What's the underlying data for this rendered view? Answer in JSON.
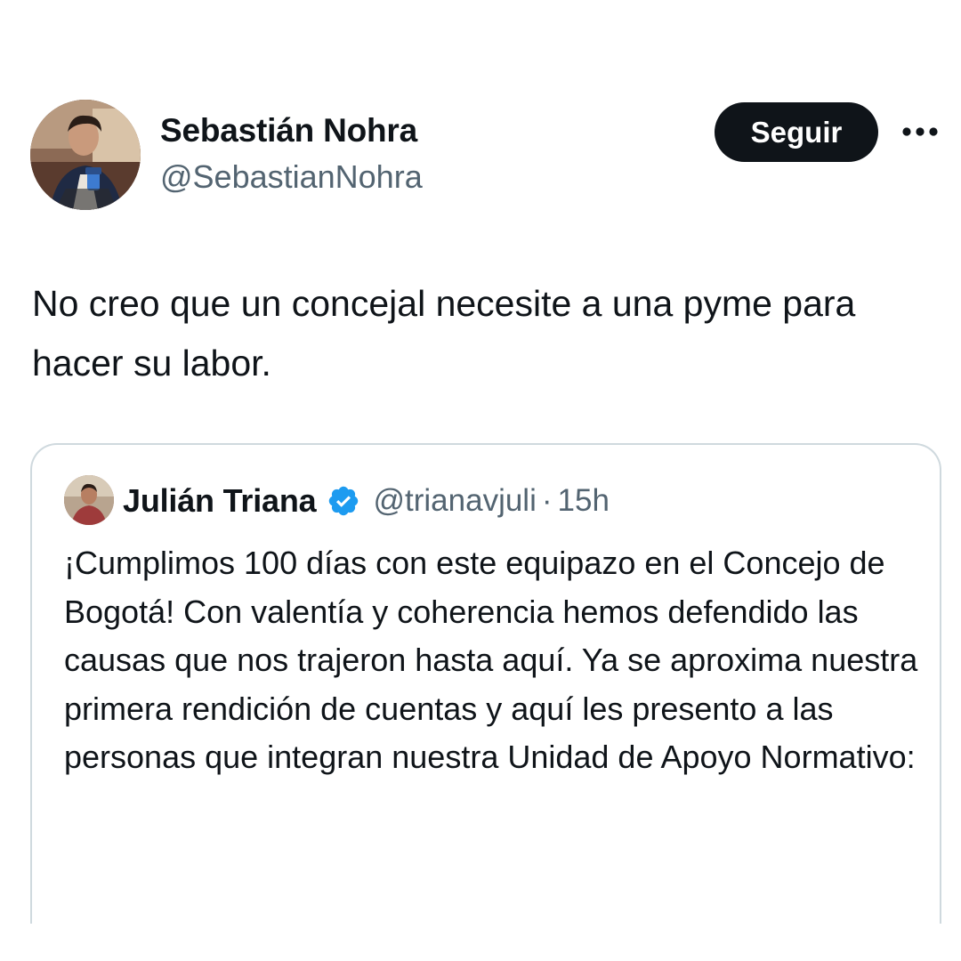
{
  "author": {
    "name": "Sebastián Nohra",
    "handle": "@SebastianNohra",
    "avatar_icon": "profile-photo"
  },
  "actions": {
    "follow_label": "Seguir",
    "more_icon": "more-horizontal-icon"
  },
  "tweet": {
    "text": "No creo que un concejal necesite a una pyme para hacer su labor."
  },
  "quoted_tweet": {
    "author_name": "Julián Triana",
    "verified": true,
    "verified_color": "#1d9bf0",
    "handle": "@trianavjuli",
    "separator": "·",
    "time": "15h",
    "text": "¡Cumplimos 100 días con este equipazo en el Concejo de Bogotá! Con valentía y coherencia hemos defendido las causas que nos trajeron hasta aquí. Ya se aproxima nuestra primera rendición de cuentas y aquí les presento a las personas que integran nuestra Unidad de Apoyo Normativo:"
  },
  "colors": {
    "text_primary": "#0f1419",
    "text_secondary": "#536471",
    "border": "#cfd9de",
    "button_bg": "#0f1419",
    "button_text": "#ffffff"
  }
}
